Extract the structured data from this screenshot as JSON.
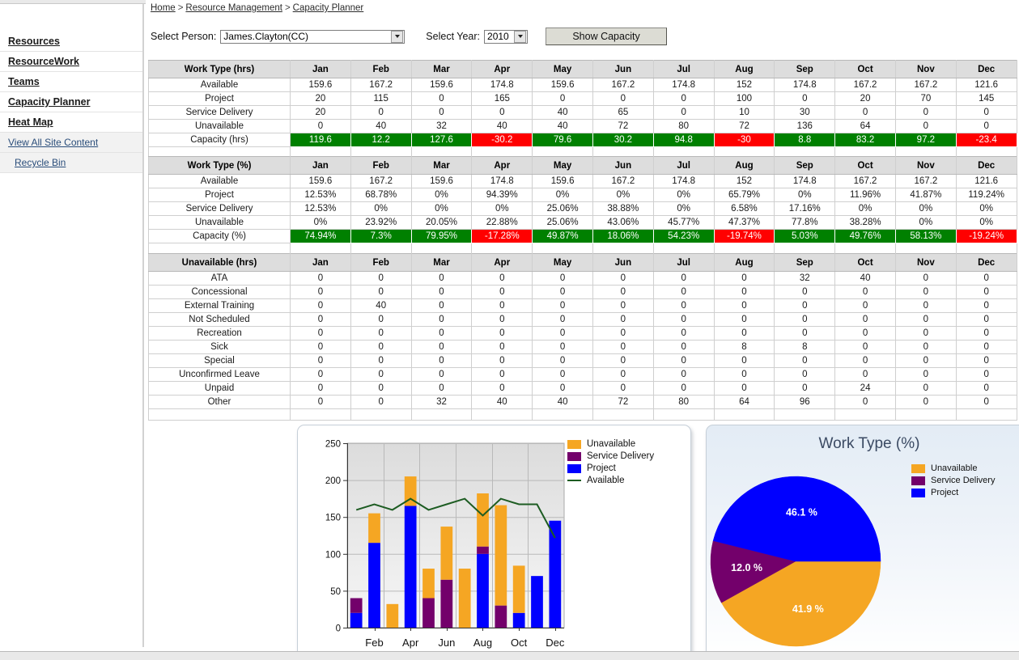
{
  "sidebar": {
    "items": [
      {
        "label": "Resources",
        "style": "primary"
      },
      {
        "label": "ResourceWork",
        "style": "primary"
      },
      {
        "label": "Teams",
        "style": "primary"
      },
      {
        "label": "Capacity Planner",
        "style": "primary"
      },
      {
        "label": "Heat Map",
        "style": "primary"
      },
      {
        "label": "View All Site Content",
        "style": "secondary"
      },
      {
        "label": "Recycle Bin",
        "style": "secondary-indent"
      }
    ]
  },
  "breadcrumb": {
    "home": "Home",
    "sep1": ">",
    "resource_management": "Resource Management",
    "sep2": ">",
    "capacity_planner": "Capacity Planner"
  },
  "controls": {
    "person_label": "Select Person:",
    "person_value": "James.Clayton(CC)",
    "year_label": "Select Year:",
    "year_value": "2010",
    "show_capacity_label": "Show Capacity"
  },
  "months": [
    "Jan",
    "Feb",
    "Mar",
    "Apr",
    "May",
    "Jun",
    "Jul",
    "Aug",
    "Sep",
    "Oct",
    "Nov",
    "Dec"
  ],
  "table_hours": {
    "header_label": "Work Type (hrs)",
    "rows": [
      {
        "label": "Available",
        "values": [
          "159.6",
          "167.2",
          "159.6",
          "174.8",
          "159.6",
          "167.2",
          "174.8",
          "152",
          "174.8",
          "167.2",
          "167.2",
          "121.6"
        ]
      },
      {
        "label": "Project",
        "values": [
          "20",
          "115",
          "0",
          "165",
          "0",
          "0",
          "0",
          "100",
          "0",
          "20",
          "70",
          "145"
        ]
      },
      {
        "label": "Service Delivery",
        "values": [
          "20",
          "0",
          "0",
          "0",
          "40",
          "65",
          "0",
          "10",
          "30",
          "0",
          "0",
          "0"
        ]
      },
      {
        "label": "Unavailable",
        "values": [
          "0",
          "40",
          "32",
          "40",
          "40",
          "72",
          "80",
          "72",
          "136",
          "64",
          "0",
          "0"
        ]
      }
    ],
    "capacity": {
      "label": "Capacity (hrs)",
      "values": [
        "119.6",
        "12.2",
        "127.6",
        "-30.2",
        "79.6",
        "30.2",
        "94.8",
        "-30",
        "8.8",
        "83.2",
        "97.2",
        "-23.4"
      ],
      "signs": [
        "pos",
        "pos",
        "pos",
        "neg",
        "pos",
        "pos",
        "pos",
        "neg",
        "pos",
        "pos",
        "pos",
        "neg"
      ]
    }
  },
  "table_percent": {
    "header_label": "Work Type (%)",
    "rows": [
      {
        "label": "Available",
        "values": [
          "159.6",
          "167.2",
          "159.6",
          "174.8",
          "159.6",
          "167.2",
          "174.8",
          "152",
          "174.8",
          "167.2",
          "167.2",
          "121.6"
        ]
      },
      {
        "label": "Project",
        "values": [
          "12.53%",
          "68.78%",
          "0%",
          "94.39%",
          "0%",
          "0%",
          "0%",
          "65.79%",
          "0%",
          "11.96%",
          "41.87%",
          "119.24%"
        ]
      },
      {
        "label": "Service Delivery",
        "values": [
          "12.53%",
          "0%",
          "0%",
          "0%",
          "25.06%",
          "38.88%",
          "0%",
          "6.58%",
          "17.16%",
          "0%",
          "0%",
          "0%"
        ]
      },
      {
        "label": "Unavailable",
        "values": [
          "0%",
          "23.92%",
          "20.05%",
          "22.88%",
          "25.06%",
          "43.06%",
          "45.77%",
          "47.37%",
          "77.8%",
          "38.28%",
          "0%",
          "0%"
        ]
      }
    ],
    "capacity": {
      "label": "Capacity (%)",
      "values": [
        "74.94%",
        "7.3%",
        "79.95%",
        "-17.28%",
        "49.87%",
        "18.06%",
        "54.23%",
        "-19.74%",
        "5.03%",
        "49.76%",
        "58.13%",
        "-19.24%"
      ],
      "signs": [
        "pos",
        "pos",
        "pos",
        "neg",
        "pos",
        "pos",
        "pos",
        "neg",
        "pos",
        "pos",
        "pos",
        "neg"
      ]
    }
  },
  "table_unavailable": {
    "header_label": "Unavailable (hrs)",
    "rows": [
      {
        "label": "ATA",
        "values": [
          "0",
          "0",
          "0",
          "0",
          "0",
          "0",
          "0",
          "0",
          "32",
          "40",
          "0",
          "0"
        ]
      },
      {
        "label": "Concessional",
        "values": [
          "0",
          "0",
          "0",
          "0",
          "0",
          "0",
          "0",
          "0",
          "0",
          "0",
          "0",
          "0"
        ]
      },
      {
        "label": "External Training",
        "values": [
          "0",
          "40",
          "0",
          "0",
          "0",
          "0",
          "0",
          "0",
          "0",
          "0",
          "0",
          "0"
        ]
      },
      {
        "label": "Not Scheduled",
        "values": [
          "0",
          "0",
          "0",
          "0",
          "0",
          "0",
          "0",
          "0",
          "0",
          "0",
          "0",
          "0"
        ]
      },
      {
        "label": "Recreation",
        "values": [
          "0",
          "0",
          "0",
          "0",
          "0",
          "0",
          "0",
          "0",
          "0",
          "0",
          "0",
          "0"
        ]
      },
      {
        "label": "Sick",
        "values": [
          "0",
          "0",
          "0",
          "0",
          "0",
          "0",
          "0",
          "8",
          "8",
          "0",
          "0",
          "0"
        ]
      },
      {
        "label": "Special",
        "values": [
          "0",
          "0",
          "0",
          "0",
          "0",
          "0",
          "0",
          "0",
          "0",
          "0",
          "0",
          "0"
        ]
      },
      {
        "label": "Unconfirmed Leave",
        "values": [
          "0",
          "0",
          "0",
          "0",
          "0",
          "0",
          "0",
          "0",
          "0",
          "0",
          "0",
          "0"
        ]
      },
      {
        "label": "Unpaid",
        "values": [
          "0",
          "0",
          "0",
          "0",
          "0",
          "0",
          "0",
          "0",
          "0",
          "24",
          "0",
          "0"
        ]
      },
      {
        "label": "Other",
        "values": [
          "0",
          "0",
          "32",
          "40",
          "40",
          "72",
          "80",
          "64",
          "96",
          "0",
          "0",
          "0"
        ]
      }
    ]
  },
  "colors": {
    "unavailable": "#F5A623",
    "service_delivery": "#73006B",
    "project": "#0000FF",
    "available": "#1D5C22",
    "positive": "#008000",
    "negative": "#FF0000",
    "header_bg": "#DDDDDD"
  },
  "chart_data": [
    {
      "type": "bar",
      "name": "capacity-bar-chart",
      "stacked": true,
      "title": "",
      "xlabel": "",
      "ylabel": "",
      "categories": [
        "Jan",
        "Feb",
        "Mar",
        "Apr",
        "May",
        "Jun",
        "Jul",
        "Aug",
        "Sep",
        "Oct",
        "Nov",
        "Dec"
      ],
      "visible_tick_labels": [
        "Feb",
        "Apr",
        "Jun",
        "Aug",
        "Oct",
        "Dec"
      ],
      "ylim": [
        0,
        250
      ],
      "yticks": [
        0,
        50,
        100,
        150,
        200,
        250
      ],
      "grid": true,
      "legend_position": "right",
      "series": [
        {
          "name": "Project",
          "color": "#0000FF",
          "values": [
            20,
            115,
            0,
            165,
            0,
            0,
            0,
            100,
            0,
            20,
            70,
            145
          ]
        },
        {
          "name": "Service Delivery",
          "color": "#73006B",
          "values": [
            20,
            0,
            0,
            0,
            40,
            65,
            0,
            10,
            30,
            0,
            0,
            0
          ]
        },
        {
          "name": "Unavailable",
          "color": "#F5A623",
          "values": [
            0,
            40,
            32,
            40,
            40,
            72,
            80,
            72,
            136,
            64,
            0,
            0
          ]
        }
      ],
      "line_series": [
        {
          "name": "Available",
          "color": "#1D5C22",
          "values": [
            159.6,
            167.2,
            159.6,
            174.8,
            159.6,
            167.2,
            174.8,
            152,
            174.8,
            167.2,
            167.2,
            121.6
          ]
        }
      ],
      "legend": [
        "Unavailable",
        "Service Delivery",
        "Project",
        "Available"
      ]
    },
    {
      "type": "pie",
      "name": "work-type-pie-chart",
      "title": "Work Type (%)",
      "legend_position": "right",
      "legend": [
        "Unavailable",
        "Service Delivery",
        "Project"
      ],
      "labels": [
        "Unavailable",
        "Service Delivery",
        "Project"
      ],
      "values": [
        41.9,
        12.0,
        46.1
      ],
      "display_labels": [
        "41.9 %",
        "12.0 %",
        "46.1 %"
      ],
      "colors": [
        "#F5A623",
        "#73006B",
        "#0000FF"
      ]
    }
  ]
}
